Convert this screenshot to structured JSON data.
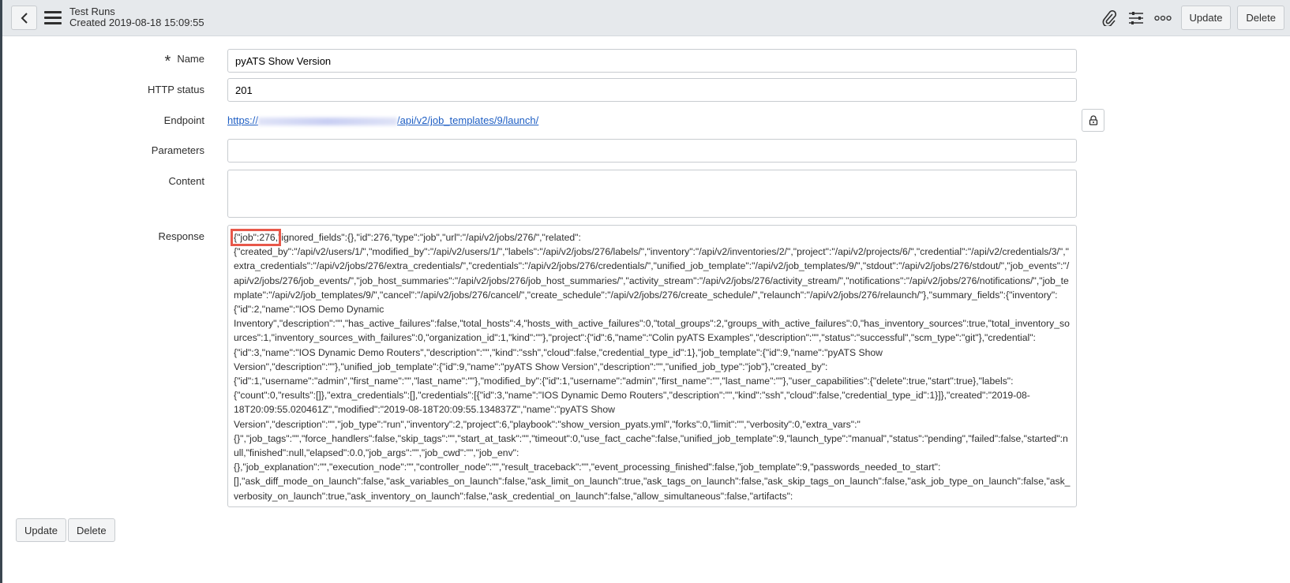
{
  "header": {
    "title": "Test Runs",
    "subtitle": "Created 2019-08-18 15:09:55",
    "update_label": "Update",
    "delete_label": "Delete"
  },
  "form": {
    "name_label": "Name",
    "name_value": "pyATS Show Version",
    "http_status_label": "HTTP status",
    "http_status_value": "201",
    "endpoint_label": "Endpoint",
    "endpoint_prefix": "https://",
    "endpoint_path": "/api/v2/job_templates/9/launch/",
    "parameters_label": "Parameters",
    "parameters_value": "",
    "content_label": "Content",
    "content_value": "",
    "response_label": "Response",
    "response_highlight": "{\"job\":276,",
    "response_rest": "\"ignored_fields\":{},\"id\":276,\"type\":\"job\",\"url\":\"/api/v2/jobs/276/\",\"related\":{\"created_by\":\"/api/v2/users/1/\",\"modified_by\":\"/api/v2/users/1/\",\"labels\":\"/api/v2/jobs/276/labels/\",\"inventory\":\"/api/v2/inventories/2/\",\"project\":\"/api/v2/projects/6/\",\"credential\":\"/api/v2/credentials/3/\",\"extra_credentials\":\"/api/v2/jobs/276/extra_credentials/\",\"credentials\":\"/api/v2/jobs/276/credentials/\",\"unified_job_template\":\"/api/v2/job_templates/9/\",\"stdout\":\"/api/v2/jobs/276/stdout/\",\"job_events\":\"/api/v2/jobs/276/job_events/\",\"job_host_summaries\":\"/api/v2/jobs/276/job_host_summaries/\",\"activity_stream\":\"/api/v2/jobs/276/activity_stream/\",\"notifications\":\"/api/v2/jobs/276/notifications/\",\"job_template\":\"/api/v2/job_templates/9/\",\"cancel\":\"/api/v2/jobs/276/cancel/\",\"create_schedule\":\"/api/v2/jobs/276/create_schedule/\",\"relaunch\":\"/api/v2/jobs/276/relaunch/\"},\"summary_fields\":{\"inventory\":{\"id\":2,\"name\":\"IOS Demo Dynamic Inventory\",\"description\":\"\",\"has_active_failures\":false,\"total_hosts\":4,\"hosts_with_active_failures\":0,\"total_groups\":2,\"groups_with_active_failures\":0,\"has_inventory_sources\":true,\"total_inventory_sources\":1,\"inventory_sources_with_failures\":0,\"organization_id\":1,\"kind\":\"\"},\"project\":{\"id\":6,\"name\":\"Colin pyATS Examples\",\"description\":\"\",\"status\":\"successful\",\"scm_type\":\"git\"},\"credential\":{\"id\":3,\"name\":\"IOS Dynamic Demo Routers\",\"description\":\"\",\"kind\":\"ssh\",\"cloud\":false,\"credential_type_id\":1},\"job_template\":{\"id\":9,\"name\":\"pyATS Show Version\",\"description\":\"\"},\"unified_job_template\":{\"id\":9,\"name\":\"pyATS Show Version\",\"description\":\"\",\"unified_job_type\":\"job\"},\"created_by\":{\"id\":1,\"username\":\"admin\",\"first_name\":\"\",\"last_name\":\"\"},\"modified_by\":{\"id\":1,\"username\":\"admin\",\"first_name\":\"\",\"last_name\":\"\"},\"user_capabilities\":{\"delete\":true,\"start\":true},\"labels\":{\"count\":0,\"results\":[]},\"extra_credentials\":[],\"credentials\":[{\"id\":3,\"name\":\"IOS Dynamic Demo Routers\",\"description\":\"\",\"kind\":\"ssh\",\"cloud\":false,\"credential_type_id\":1}]},\"created\":\"2019-08-18T20:09:55.020461Z\",\"modified\":\"2019-08-18T20:09:55.134837Z\",\"name\":\"pyATS Show Version\",\"description\":\"\",\"job_type\":\"run\",\"inventory\":2,\"project\":6,\"playbook\":\"show_version_pyats.yml\",\"forks\":0,\"limit\":\"\",\"verbosity\":0,\"extra_vars\":\"{}\",\"job_tags\":\"\",\"force_handlers\":false,\"skip_tags\":\"\",\"start_at_task\":\"\",\"timeout\":0,\"use_fact_cache\":false,\"unified_job_template\":9,\"launch_type\":\"manual\",\"status\":\"pending\",\"failed\":false,\"started\":null,\"finished\":null,\"elapsed\":0.0,\"job_args\":\"\",\"job_cwd\":\"\",\"job_env\":{},\"job_explanation\":\"\",\"execution_node\":\"\",\"controller_node\":\"\",\"result_traceback\":\"\",\"event_processing_finished\":false,\"job_template\":9,\"passwords_needed_to_start\":[],\"ask_diff_mode_on_launch\":false,\"ask_variables_on_launch\":false,\"ask_limit_on_launch\":true,\"ask_tags_on_launch\":false,\"ask_skip_tags_on_launch\":false,\"ask_job_type_on_launch\":false,\"ask_verbosity_on_launch\":true,\"ask_inventory_on_launch\":false,\"ask_credential_on_launch\":false,\"allow_simultaneous\":false,\"artifacts\":{},\"scm_revision\":\"\",\"instance_group\":null,\"diff_mode\":false,\"job_slice_number\":0,\"job_slice_count\":1,\"credential\":3,\"vault_credential\":null}"
  },
  "footer": {
    "update_label": "Update",
    "delete_label": "Delete"
  },
  "colors": {
    "highlight": "#e8584a",
    "link": "#1f5fc4",
    "header_bg": "#e6e9ec"
  }
}
